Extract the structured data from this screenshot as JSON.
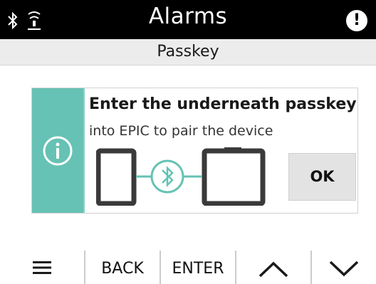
{
  "header": {
    "title": "Alarms",
    "left_icons": [
      "bluetooth-icon",
      "wireless-signal-icon"
    ],
    "right_icon": "alert-icon",
    "alert_glyph": "!"
  },
  "subheader": {
    "title": "Passkey"
  },
  "dialog": {
    "icon": "info-icon",
    "heading": "Enter the underneath passkey",
    "body": "into EPIC to pair the device",
    "graphic": [
      "device-icon",
      "bluetooth-icon",
      "controller-icon"
    ],
    "ok_label": "OK",
    "accent_color": "#66c2b4"
  },
  "bottom_nav": {
    "menu_icon": "menu-icon",
    "back_label": "BACK",
    "enter_label": "ENTER",
    "up_icon": "chevron-up-icon",
    "down_icon": "chevron-down-icon"
  }
}
